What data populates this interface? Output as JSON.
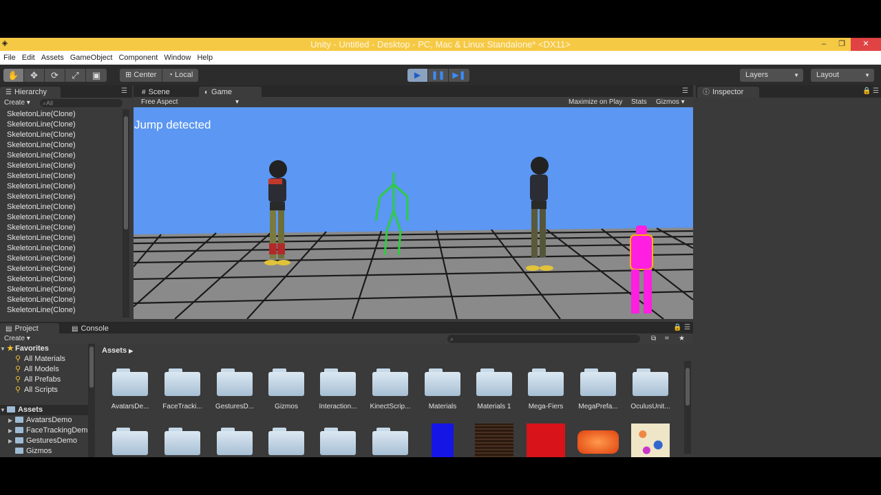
{
  "window": {
    "title": "Unity - Untitled - Desktop - PC, Mac & Linux Standalone* <DX11>",
    "controls": [
      "–",
      "❐",
      "✕"
    ]
  },
  "menu": [
    "File",
    "Edit",
    "Assets",
    "GameObject",
    "Component",
    "Window",
    "Help"
  ],
  "toolbar": {
    "transform_tools": [
      "hand-icon",
      "move-icon",
      "rotate-icon",
      "scale-icon",
      "rect-icon"
    ],
    "pivot_label": "Center",
    "space_label": "Local",
    "layers_label": "Layers",
    "layout_label": "Layout"
  },
  "hierarchy": {
    "tab_label": "Hierarchy",
    "create_label": "Create",
    "search_placeholder": "All",
    "items": [
      "SkeletonLine(Clone)",
      "SkeletonLine(Clone)",
      "SkeletonLine(Clone)",
      "SkeletonLine(Clone)",
      "SkeletonLine(Clone)",
      "SkeletonLine(Clone)",
      "SkeletonLine(Clone)",
      "SkeletonLine(Clone)",
      "SkeletonLine(Clone)",
      "SkeletonLine(Clone)",
      "SkeletonLine(Clone)",
      "SkeletonLine(Clone)",
      "SkeletonLine(Clone)",
      "SkeletonLine(Clone)",
      "SkeletonLine(Clone)",
      "SkeletonLine(Clone)",
      "SkeletonLine(Clone)",
      "SkeletonLine(Clone)",
      "SkeletonLine(Clone)",
      "SkeletonLine(Clone)"
    ]
  },
  "game": {
    "scene_tab": "Scene",
    "game_tab": "Game",
    "aspect_label": "Free Aspect",
    "maximize_label": "Maximize on Play",
    "stats_label": "Stats",
    "gizmos_label": "Gizmos",
    "overlay_text": "Jump detected",
    "sky_color": "#5b97f3",
    "ground_color": "#8a8a8a"
  },
  "inspector": {
    "tab_label": "Inspector"
  },
  "project": {
    "project_tab": "Project",
    "console_tab": "Console",
    "create_label": "Create",
    "breadcrumb": "Assets",
    "favorites_label": "Favorites",
    "favorites": [
      "All Materials",
      "All Models",
      "All Prefabs",
      "All Scripts"
    ],
    "assets_label": "Assets",
    "tree": [
      "AvatarsDemo",
      "FaceTrackingDemo",
      "GesturesDemo",
      "Gizmos"
    ],
    "grid_row1": [
      "AvatarsDe...",
      "FaceTracki...",
      "GesturesD...",
      "Gizmos",
      "Interaction...",
      "KinectScrip...",
      "Materials",
      "Materials 1",
      "Mega-Fiers",
      "MegaPrefa...",
      "OculusUnit..."
    ],
    "grid_row2_thumbs": [
      "folder",
      "folder",
      "folder",
      "folder",
      "folder",
      "folder",
      "#1515e6",
      "#3a2416",
      "#d8141a",
      "#ee5a1c",
      "#e9e2c2"
    ]
  }
}
